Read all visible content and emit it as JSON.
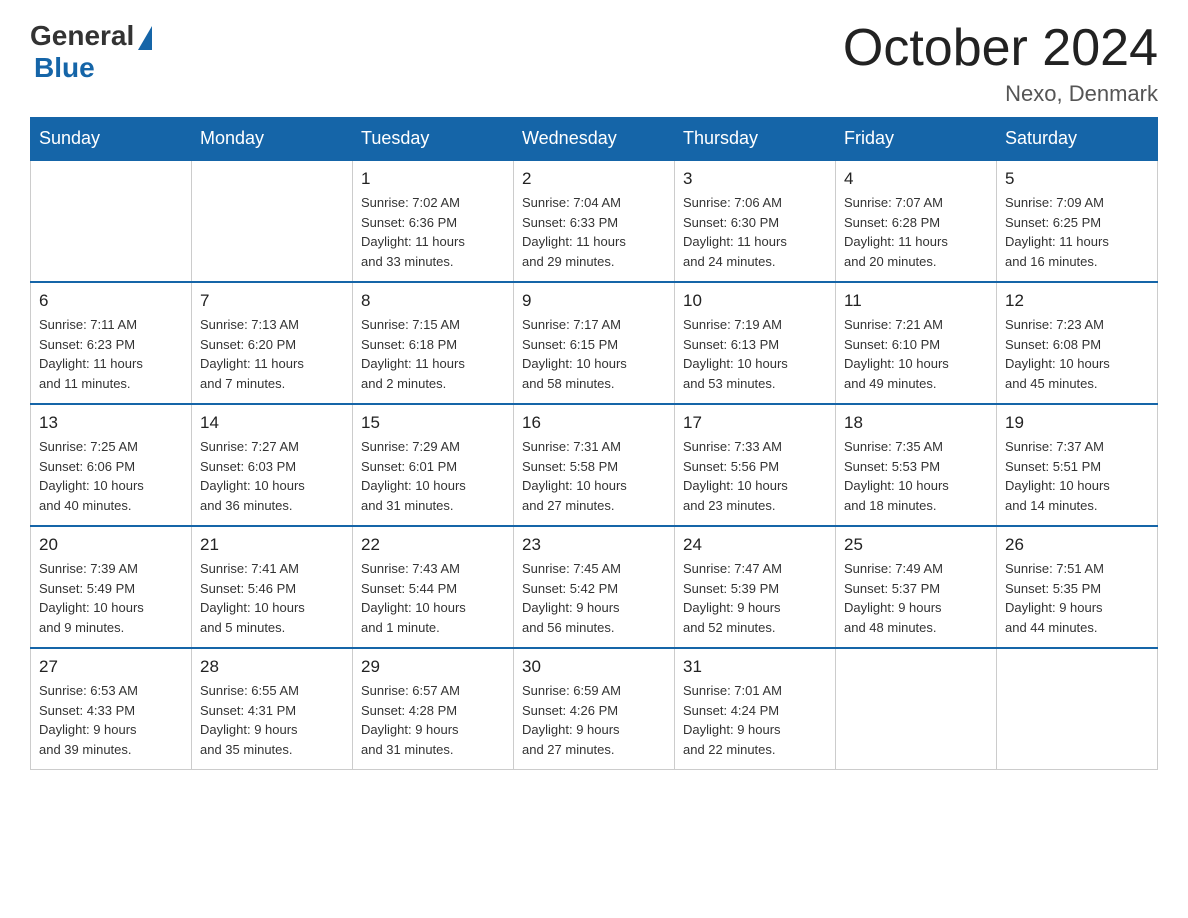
{
  "header": {
    "title": "October 2024",
    "location": "Nexo, Denmark",
    "logo_general": "General",
    "logo_blue": "Blue"
  },
  "days_of_week": [
    "Sunday",
    "Monday",
    "Tuesday",
    "Wednesday",
    "Thursday",
    "Friday",
    "Saturday"
  ],
  "weeks": [
    [
      {
        "day": "",
        "info": ""
      },
      {
        "day": "",
        "info": ""
      },
      {
        "day": "1",
        "info": "Sunrise: 7:02 AM\nSunset: 6:36 PM\nDaylight: 11 hours\nand 33 minutes."
      },
      {
        "day": "2",
        "info": "Sunrise: 7:04 AM\nSunset: 6:33 PM\nDaylight: 11 hours\nand 29 minutes."
      },
      {
        "day": "3",
        "info": "Sunrise: 7:06 AM\nSunset: 6:30 PM\nDaylight: 11 hours\nand 24 minutes."
      },
      {
        "day": "4",
        "info": "Sunrise: 7:07 AM\nSunset: 6:28 PM\nDaylight: 11 hours\nand 20 minutes."
      },
      {
        "day": "5",
        "info": "Sunrise: 7:09 AM\nSunset: 6:25 PM\nDaylight: 11 hours\nand 16 minutes."
      }
    ],
    [
      {
        "day": "6",
        "info": "Sunrise: 7:11 AM\nSunset: 6:23 PM\nDaylight: 11 hours\nand 11 minutes."
      },
      {
        "day": "7",
        "info": "Sunrise: 7:13 AM\nSunset: 6:20 PM\nDaylight: 11 hours\nand 7 minutes."
      },
      {
        "day": "8",
        "info": "Sunrise: 7:15 AM\nSunset: 6:18 PM\nDaylight: 11 hours\nand 2 minutes."
      },
      {
        "day": "9",
        "info": "Sunrise: 7:17 AM\nSunset: 6:15 PM\nDaylight: 10 hours\nand 58 minutes."
      },
      {
        "day": "10",
        "info": "Sunrise: 7:19 AM\nSunset: 6:13 PM\nDaylight: 10 hours\nand 53 minutes."
      },
      {
        "day": "11",
        "info": "Sunrise: 7:21 AM\nSunset: 6:10 PM\nDaylight: 10 hours\nand 49 minutes."
      },
      {
        "day": "12",
        "info": "Sunrise: 7:23 AM\nSunset: 6:08 PM\nDaylight: 10 hours\nand 45 minutes."
      }
    ],
    [
      {
        "day": "13",
        "info": "Sunrise: 7:25 AM\nSunset: 6:06 PM\nDaylight: 10 hours\nand 40 minutes."
      },
      {
        "day": "14",
        "info": "Sunrise: 7:27 AM\nSunset: 6:03 PM\nDaylight: 10 hours\nand 36 minutes."
      },
      {
        "day": "15",
        "info": "Sunrise: 7:29 AM\nSunset: 6:01 PM\nDaylight: 10 hours\nand 31 minutes."
      },
      {
        "day": "16",
        "info": "Sunrise: 7:31 AM\nSunset: 5:58 PM\nDaylight: 10 hours\nand 27 minutes."
      },
      {
        "day": "17",
        "info": "Sunrise: 7:33 AM\nSunset: 5:56 PM\nDaylight: 10 hours\nand 23 minutes."
      },
      {
        "day": "18",
        "info": "Sunrise: 7:35 AM\nSunset: 5:53 PM\nDaylight: 10 hours\nand 18 minutes."
      },
      {
        "day": "19",
        "info": "Sunrise: 7:37 AM\nSunset: 5:51 PM\nDaylight: 10 hours\nand 14 minutes."
      }
    ],
    [
      {
        "day": "20",
        "info": "Sunrise: 7:39 AM\nSunset: 5:49 PM\nDaylight: 10 hours\nand 9 minutes."
      },
      {
        "day": "21",
        "info": "Sunrise: 7:41 AM\nSunset: 5:46 PM\nDaylight: 10 hours\nand 5 minutes."
      },
      {
        "day": "22",
        "info": "Sunrise: 7:43 AM\nSunset: 5:44 PM\nDaylight: 10 hours\nand 1 minute."
      },
      {
        "day": "23",
        "info": "Sunrise: 7:45 AM\nSunset: 5:42 PM\nDaylight: 9 hours\nand 56 minutes."
      },
      {
        "day": "24",
        "info": "Sunrise: 7:47 AM\nSunset: 5:39 PM\nDaylight: 9 hours\nand 52 minutes."
      },
      {
        "day": "25",
        "info": "Sunrise: 7:49 AM\nSunset: 5:37 PM\nDaylight: 9 hours\nand 48 minutes."
      },
      {
        "day": "26",
        "info": "Sunrise: 7:51 AM\nSunset: 5:35 PM\nDaylight: 9 hours\nand 44 minutes."
      }
    ],
    [
      {
        "day": "27",
        "info": "Sunrise: 6:53 AM\nSunset: 4:33 PM\nDaylight: 9 hours\nand 39 minutes."
      },
      {
        "day": "28",
        "info": "Sunrise: 6:55 AM\nSunset: 4:31 PM\nDaylight: 9 hours\nand 35 minutes."
      },
      {
        "day": "29",
        "info": "Sunrise: 6:57 AM\nSunset: 4:28 PM\nDaylight: 9 hours\nand 31 minutes."
      },
      {
        "day": "30",
        "info": "Sunrise: 6:59 AM\nSunset: 4:26 PM\nDaylight: 9 hours\nand 27 minutes."
      },
      {
        "day": "31",
        "info": "Sunrise: 7:01 AM\nSunset: 4:24 PM\nDaylight: 9 hours\nand 22 minutes."
      },
      {
        "day": "",
        "info": ""
      },
      {
        "day": "",
        "info": ""
      }
    ]
  ]
}
